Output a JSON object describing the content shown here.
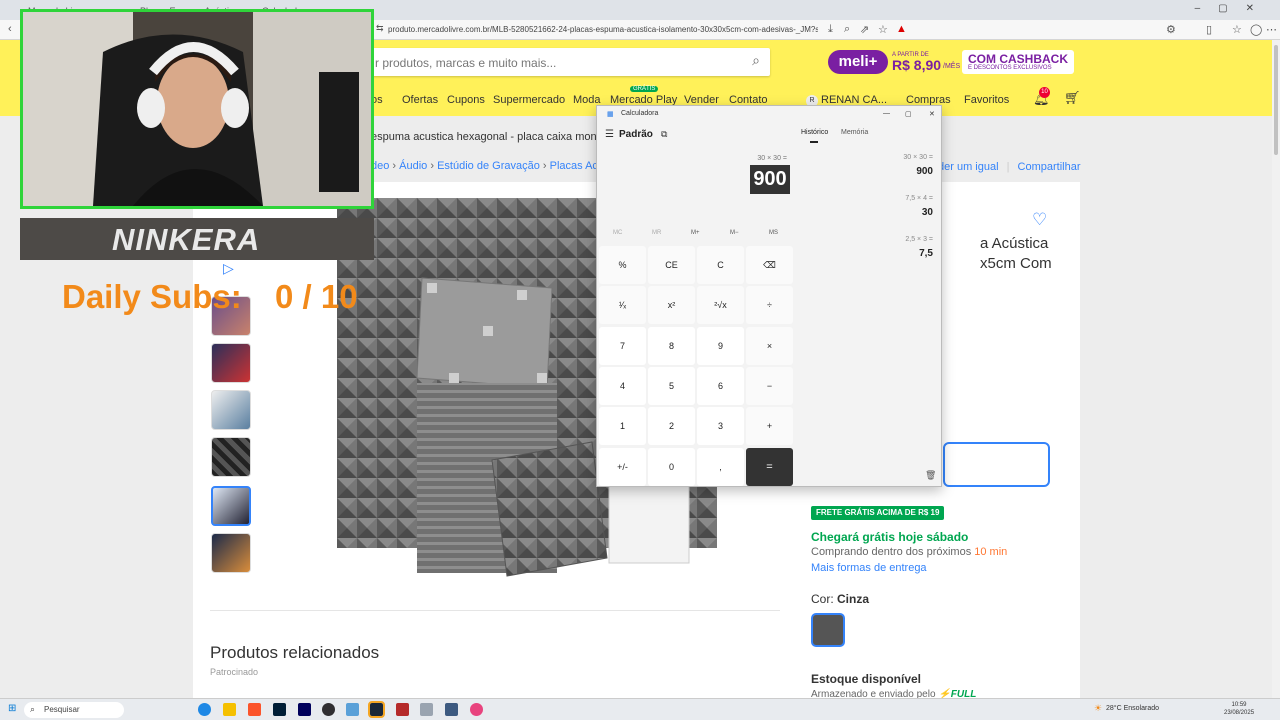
{
  "browser": {
    "tabs": [
      "Mercado Livre",
      "Placas Espuma Acústica",
      "Calculadora"
    ],
    "url": "produto.mercadolivre.com.br/MLB-5280521662-24-placas-espuma-acustica-isolamento-30x30x5cm-com-adesivas-_JM?searchVariation=1..."
  },
  "header": {
    "search_placeholder": "r produtos, marcas e muito mais...",
    "meli_badge": "meli+",
    "meli_apartir": "A PARTIR DE",
    "meli_price": "R$ 8,90",
    "meli_per": "/MÊS",
    "cashback_title": "COM CASHBACK",
    "cashback_sub": "E DESCONTOS EXCLUSIVOS",
    "nav": [
      "os",
      "Ofertas",
      "Cupons",
      "Supermercado",
      "Moda",
      "Mercado Play",
      "Vender",
      "Contato"
    ],
    "gratis_tag": "GRÁTIS",
    "user_initial": "R",
    "user_name": "RENAN CA...",
    "compras": "Compras",
    "favoritos": "Favoritos",
    "notif_count": "10"
  },
  "product": {
    "search_note": "espuma acustica hexagonal - placa caixa mondial",
    "crumbs": [
      "deo",
      "Áudio",
      "Estúdio de Gravação",
      "Placas Ac"
    ],
    "crumbs_right": [
      "der um igual",
      "Compartilhar"
    ],
    "title_line1": "a Acústica",
    "title_line2": "x5cm Com",
    "frete_badge": "FRETE GRÁTIS ACIMA DE R$ 19",
    "chegara": "Chegará grátis hoje sábado",
    "comprando": "Comprando dentro dos próximos",
    "comprando_time": "10 min",
    "formas": "Mais formas de entrega",
    "cor_label": "Cor:",
    "cor_value": "Cinza",
    "estoque": "Estoque disponível",
    "armazenado": "Armazenado e enviado pelo",
    "full": "FULL",
    "related": "Produtos relacionados",
    "patrocinado": "Patrocinado"
  },
  "calculator": {
    "app_title": "Calculadora",
    "mode": "Padrão",
    "expression": "30 × 30 =",
    "result": "900",
    "memory": [
      "MC",
      "MR",
      "M+",
      "M−",
      "MS"
    ],
    "keys": [
      "%",
      "CE",
      "C",
      "⌫",
      "¹⁄ₓ",
      "x²",
      "²√x",
      "÷",
      "7",
      "8",
      "9",
      "×",
      "4",
      "5",
      "6",
      "−",
      "1",
      "2",
      "3",
      "+",
      "+/-",
      "0",
      ",",
      "="
    ],
    "tab_history": "Histórico",
    "tab_memory": "Memória",
    "history": [
      {
        "expr": "30  ×  30 =",
        "result": "900"
      },
      {
        "expr": "7,5  ×  4 =",
        "result": "30"
      },
      {
        "expr": "2,5  ×  3 =",
        "result": "7,5"
      }
    ]
  },
  "overlay": {
    "nickname": "NINKERA",
    "subs_label": "Daily Subs:",
    "subs_count": "0 / 10"
  },
  "taskbar": {
    "search": "Pesquisar",
    "weather": "28°C  Ensolarado",
    "time": "10:59",
    "date": "23/08/2025"
  },
  "colors": {
    "ml_yellow": "#fff159",
    "ml_blue": "#3483fa",
    "ml_green": "#00a650",
    "overlay_green": "#2fd43a",
    "overlay_orange": "#f28a1a"
  }
}
